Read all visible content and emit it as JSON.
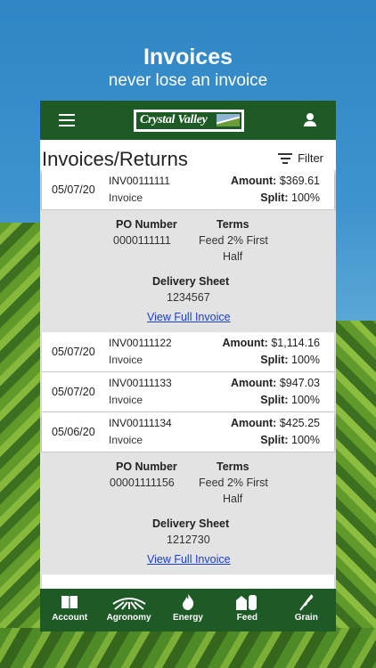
{
  "hero": {
    "title": "Invoices",
    "subtitle": "never lose an invoice"
  },
  "appbar": {
    "logo_text": "Crystal Valley"
  },
  "page": {
    "title": "Invoices/Returns",
    "filter_label": "Filter"
  },
  "invoices": [
    {
      "date": "05/07/20",
      "number": "INV00111111",
      "type": "Invoice",
      "amount_label": "Amount:",
      "amount": "$369.61",
      "split_label": "Split:",
      "split": "100%"
    },
    {
      "date": "05/07/20",
      "number": "INV00111122",
      "type": "Invoice",
      "amount_label": "Amount:",
      "amount": "$1,114.16",
      "split_label": "Split:",
      "split": "100%"
    },
    {
      "date": "05/07/20",
      "number": "INV00111133",
      "type": "Invoice",
      "amount_label": "Amount:",
      "amount": "$947.03",
      "split_label": "Split:",
      "split": "100%"
    },
    {
      "date": "05/06/20",
      "number": "INV00111134",
      "type": "Invoice",
      "amount_label": "Amount:",
      "amount": "$425.25",
      "split_label": "Split:",
      "split": "100%"
    }
  ],
  "details": [
    {
      "po_label": "PO Number",
      "po": "0000111111",
      "terms_label": "Terms",
      "terms_line1": "Feed 2% First",
      "terms_line2": "Half",
      "delivery_label": "Delivery Sheet",
      "delivery": "1234567",
      "link": "View Full Invoice"
    },
    {
      "po_label": "PO Number",
      "po": "00001111156",
      "terms_label": "Terms",
      "terms_line1": "Feed 2% First",
      "terms_line2": "Half",
      "delivery_label": "Delivery Sheet",
      "delivery": "1212730",
      "link": "View Full Invoice"
    }
  ],
  "nav": [
    {
      "label": "Account",
      "icon": "book-icon"
    },
    {
      "label": "Agronomy",
      "icon": "field-icon"
    },
    {
      "label": "Energy",
      "icon": "flame-icon"
    },
    {
      "label": "Feed",
      "icon": "barn-icon"
    },
    {
      "label": "Grain",
      "icon": "wheat-icon"
    }
  ],
  "colors": {
    "brand_green": "#1d5a26",
    "link_blue": "#1a3fd0"
  }
}
